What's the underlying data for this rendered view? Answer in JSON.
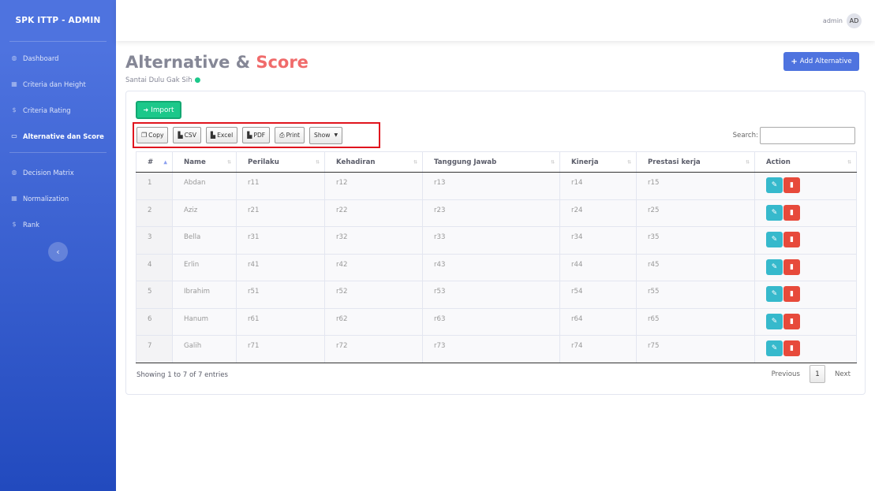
{
  "sidebar": {
    "brand": "SPK ITTP - ADMIN",
    "items": [
      {
        "label": "Dashboard",
        "icon": "gauge-icon",
        "glyph": "◍"
      },
      {
        "label": "Criteria dan Height",
        "icon": "table-icon",
        "glyph": "▦"
      },
      {
        "label": "Criteria Rating",
        "icon": "dollar-icon",
        "glyph": "$"
      },
      {
        "label": "Alternative dan Score",
        "icon": "monitor-icon",
        "glyph": "▭"
      },
      {
        "label": "Decision Matrix",
        "icon": "gauge-icon",
        "glyph": "◍"
      },
      {
        "label": "Normalization",
        "icon": "table-icon",
        "glyph": "▦"
      },
      {
        "label": "Rank",
        "icon": "dollar-icon",
        "glyph": "$"
      }
    ],
    "active_index": 3,
    "toggle_glyph": "‹"
  },
  "topbar": {
    "user_name": "admin",
    "avatar_initials": "AD"
  },
  "page": {
    "title_main": "Alternative & ",
    "title_accent": "Score",
    "subtitle": "Santai Dulu Gak Sih",
    "add_button": "Add Alternative"
  },
  "toolbar": {
    "import": "Import",
    "buttons": {
      "copy": "Copy",
      "csv": "CSV",
      "excel": "Excel",
      "pdf": "PDF",
      "print": "Print",
      "show": "Show"
    },
    "search_label": "Search:",
    "search_value": ""
  },
  "table": {
    "headers": [
      "#",
      "Name",
      "Perilaku",
      "Kehadiran",
      "Tanggung Jawab",
      "Kinerja",
      "Prestasi kerja",
      "Action"
    ],
    "rows": [
      [
        "1",
        "Abdan",
        "r11",
        "r12",
        "r13",
        "r14",
        "r15"
      ],
      [
        "2",
        "Aziz",
        "r21",
        "r22",
        "r23",
        "r24",
        "r25"
      ],
      [
        "3",
        "Bella",
        "r31",
        "r32",
        "r33",
        "r34",
        "r35"
      ],
      [
        "4",
        "Erlin",
        "r41",
        "r42",
        "r43",
        "r44",
        "r45"
      ],
      [
        "5",
        "Ibrahim",
        "r51",
        "r52",
        "r53",
        "r54",
        "r55"
      ],
      [
        "6",
        "Hanum",
        "r61",
        "r62",
        "r63",
        "r64",
        "r65"
      ],
      [
        "7",
        "Galih",
        "r71",
        "r72",
        "r73",
        "r74",
        "r75"
      ]
    ]
  },
  "footer": {
    "info": "Showing 1 to 7 of 7 entries",
    "previous": "Previous",
    "page": "1",
    "next": "Next"
  },
  "colors": {
    "primary": "#4e73df",
    "success": "#1cc88a",
    "info": "#36b9cc",
    "danger": "#e74a3b",
    "accent": "#f06b6b"
  }
}
